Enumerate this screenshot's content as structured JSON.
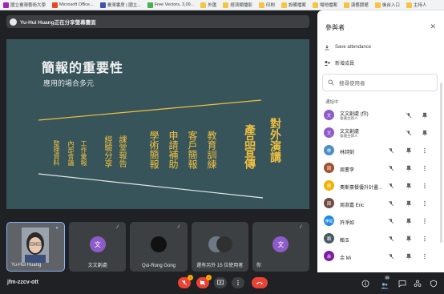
{
  "bookmarks": [
    {
      "label": "國立臺灣藝術大學",
      "color": "#9c27b0"
    },
    {
      "label": "Microsoft Office...",
      "color": "#e44b23"
    },
    {
      "label": "臺灣書房 | 國立...",
      "color": "#3f51b5"
    },
    {
      "label": "Free Vectors, 3,09...",
      "color": "#4caf50"
    },
    {
      "label": "外匯",
      "color": "folder"
    },
    {
      "label": "經濟類播影",
      "color": "folder"
    },
    {
      "label": "印刷",
      "color": "folder"
    },
    {
      "label": "設備檔案",
      "color": "folder"
    },
    {
      "label": "場地檔案",
      "color": "folder"
    },
    {
      "label": "演藝節館",
      "color": "folder"
    },
    {
      "label": "後台入口",
      "color": "folder"
    },
    {
      "label": "主持人",
      "color": "folder"
    }
  ],
  "presenting": {
    "text": "Yu-Hui Huang正在分享螢幕畫面"
  },
  "slide": {
    "title": "簡報的重要性",
    "subtitle": "應用的場合多元",
    "big": [
      "對外演講",
      "產品宣傳"
    ],
    "mid": [
      "教育訓練",
      "客戶簡報",
      "申請補助",
      "學術簡報"
    ],
    "small": [
      "課堂報告",
      "經驗分享",
      "工作彙報",
      "內部會議",
      "整理資料"
    ]
  },
  "tiles": [
    {
      "name": "Yu-Hui Huang",
      "type": "video"
    },
    {
      "name": "文文創處",
      "type": "avatar",
      "initial": "文"
    },
    {
      "name": "Qui-Rong Gong",
      "type": "photo"
    },
    {
      "name": "還有另外 15 位使用者",
      "type": "group"
    },
    {
      "name": "你",
      "type": "avatar",
      "initial": "文"
    }
  ],
  "meeting_code": "jfm-zzcv-ott",
  "controls": {
    "mic_badge": "!",
    "cam_badge": "!",
    "participants_count": "19"
  },
  "panel": {
    "title": "參與者",
    "close": "✕",
    "save_attendance": "Save attendance",
    "add_people": "新增成員",
    "search_placeholder": "搜尋使用者",
    "section_label": "通話中",
    "participants": [
      {
        "name": "文文創處 (你)",
        "sub": "會議主辦人",
        "initial": "文",
        "color": "#8e5cc8",
        "host": true
      },
      {
        "name": "文文創處",
        "sub": "會議主辦人",
        "initial": "文",
        "color": "#8e5cc8",
        "host": true
      },
      {
        "name": "林詩剴",
        "sub": "",
        "initial": "林",
        "color": "#4a90c2",
        "host": false
      },
      {
        "name": "周董李",
        "sub": "",
        "initial": "周",
        "color": "#a0522d",
        "host": false
      },
      {
        "name": "奧斯豪餐優升計畫...",
        "sub": "",
        "initial": "奧",
        "color": "#f0b400",
        "host": false
      },
      {
        "name": "周淑嘉 Eric",
        "sub": "",
        "initial": "周",
        "color": "#6d4c41",
        "host": false
      },
      {
        "name": "許淨如",
        "sub": "",
        "initial": "淨如",
        "color": "#1e88e5",
        "host": false
      },
      {
        "name": "賴玉",
        "sub": "",
        "initial": "賴",
        "color": "#455a64",
        "host": false
      },
      {
        "name": "余 Mi",
        "sub": "",
        "initial": "余",
        "color": "#7b1fa2",
        "host": false
      }
    ]
  }
}
